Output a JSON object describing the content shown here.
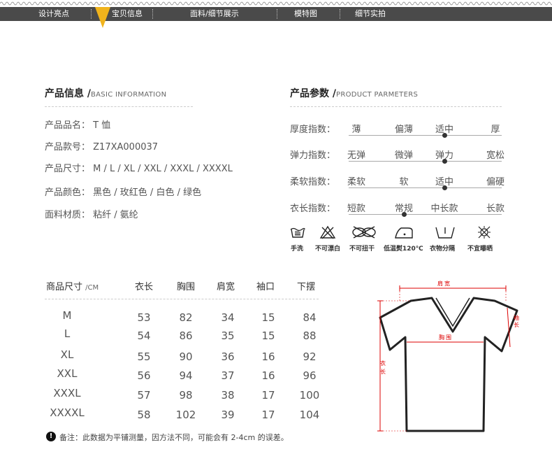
{
  "nav": {
    "items": [
      "设计亮点",
      "宝贝信息",
      "面料/细节展示",
      "模特图",
      "细节实拍"
    ],
    "active_index": 1
  },
  "product_info": {
    "title_cn": "产品信息 /",
    "title_en": "BASIC INFORMATION",
    "rows": [
      {
        "label": "产品品名：",
        "value": "T 恤"
      },
      {
        "label": "产品款号：",
        "value": "Z17XA000037"
      },
      {
        "label": "产品尺寸：",
        "value": "M / L / XL / XXL / XXXL / XXXXL"
      },
      {
        "label": "产品颜色：",
        "value": "黑色 / 玫红色 / 白色 / 绿色"
      },
      {
        "label": "面料材质：",
        "value": "粘纤 / 氨纶"
      }
    ]
  },
  "product_params": {
    "title_cn": "产品参数 /",
    "title_en": "PRODUCT PARMETERS",
    "rows": [
      {
        "label": "厚度指数：",
        "options": [
          "薄",
          "偏薄",
          "适中",
          "厚"
        ],
        "selected": 2
      },
      {
        "label": "弹力指数：",
        "options": [
          "无弹",
          "微弹",
          "弹力",
          "宽松"
        ],
        "selected": 2
      },
      {
        "label": "柔软指数：",
        "options": [
          "柔软",
          "软",
          "适中",
          "偏硬"
        ],
        "selected": 2
      },
      {
        "label": "衣长指数：",
        "options": [
          "短款",
          "常规",
          "中长款",
          "长款"
        ],
        "selected": 1
      }
    ]
  },
  "care": {
    "items": [
      {
        "icon": "hand-wash-icon",
        "label": "手洗"
      },
      {
        "icon": "no-bleach-icon",
        "label": "不可漂白"
      },
      {
        "icon": "no-wring-icon",
        "label": "不可扭干"
      },
      {
        "icon": "low-iron-icon",
        "label": "低温熨120℃"
      },
      {
        "icon": "separate-wash-icon",
        "label": "衣物分隔"
      },
      {
        "icon": "no-sun-dry-icon",
        "label": "不宜曝晒"
      }
    ]
  },
  "size_table": {
    "headers": [
      "商品尺寸",
      "衣长",
      "胸围",
      "肩宽",
      "袖口",
      "下摆"
    ],
    "unit": "/CM",
    "rows": [
      [
        "M",
        "53",
        "82",
        "34",
        "15",
        "84"
      ],
      [
        "L",
        "54",
        "86",
        "35",
        "15",
        "88"
      ],
      [
        "XL",
        "55",
        "90",
        "36",
        "16",
        "92"
      ],
      [
        "XXL",
        "56",
        "94",
        "37",
        "16",
        "96"
      ],
      [
        "XXXL",
        "57",
        "98",
        "38",
        "17",
        "100"
      ],
      [
        "XXXXL",
        "58",
        "102",
        "39",
        "17",
        "104"
      ]
    ]
  },
  "note": "备注：此数据为平铺测量，因方法不同，可能会有 2-4cm 的误差。",
  "diagram": {
    "shoulder": "肩宽",
    "sleeve": "袖长",
    "chest": "胸围",
    "length": "衣长"
  },
  "colors": {
    "nav_bg": "#4a4a4a",
    "accent": "#f0b31c",
    "measure_red": "#dd0000"
  }
}
